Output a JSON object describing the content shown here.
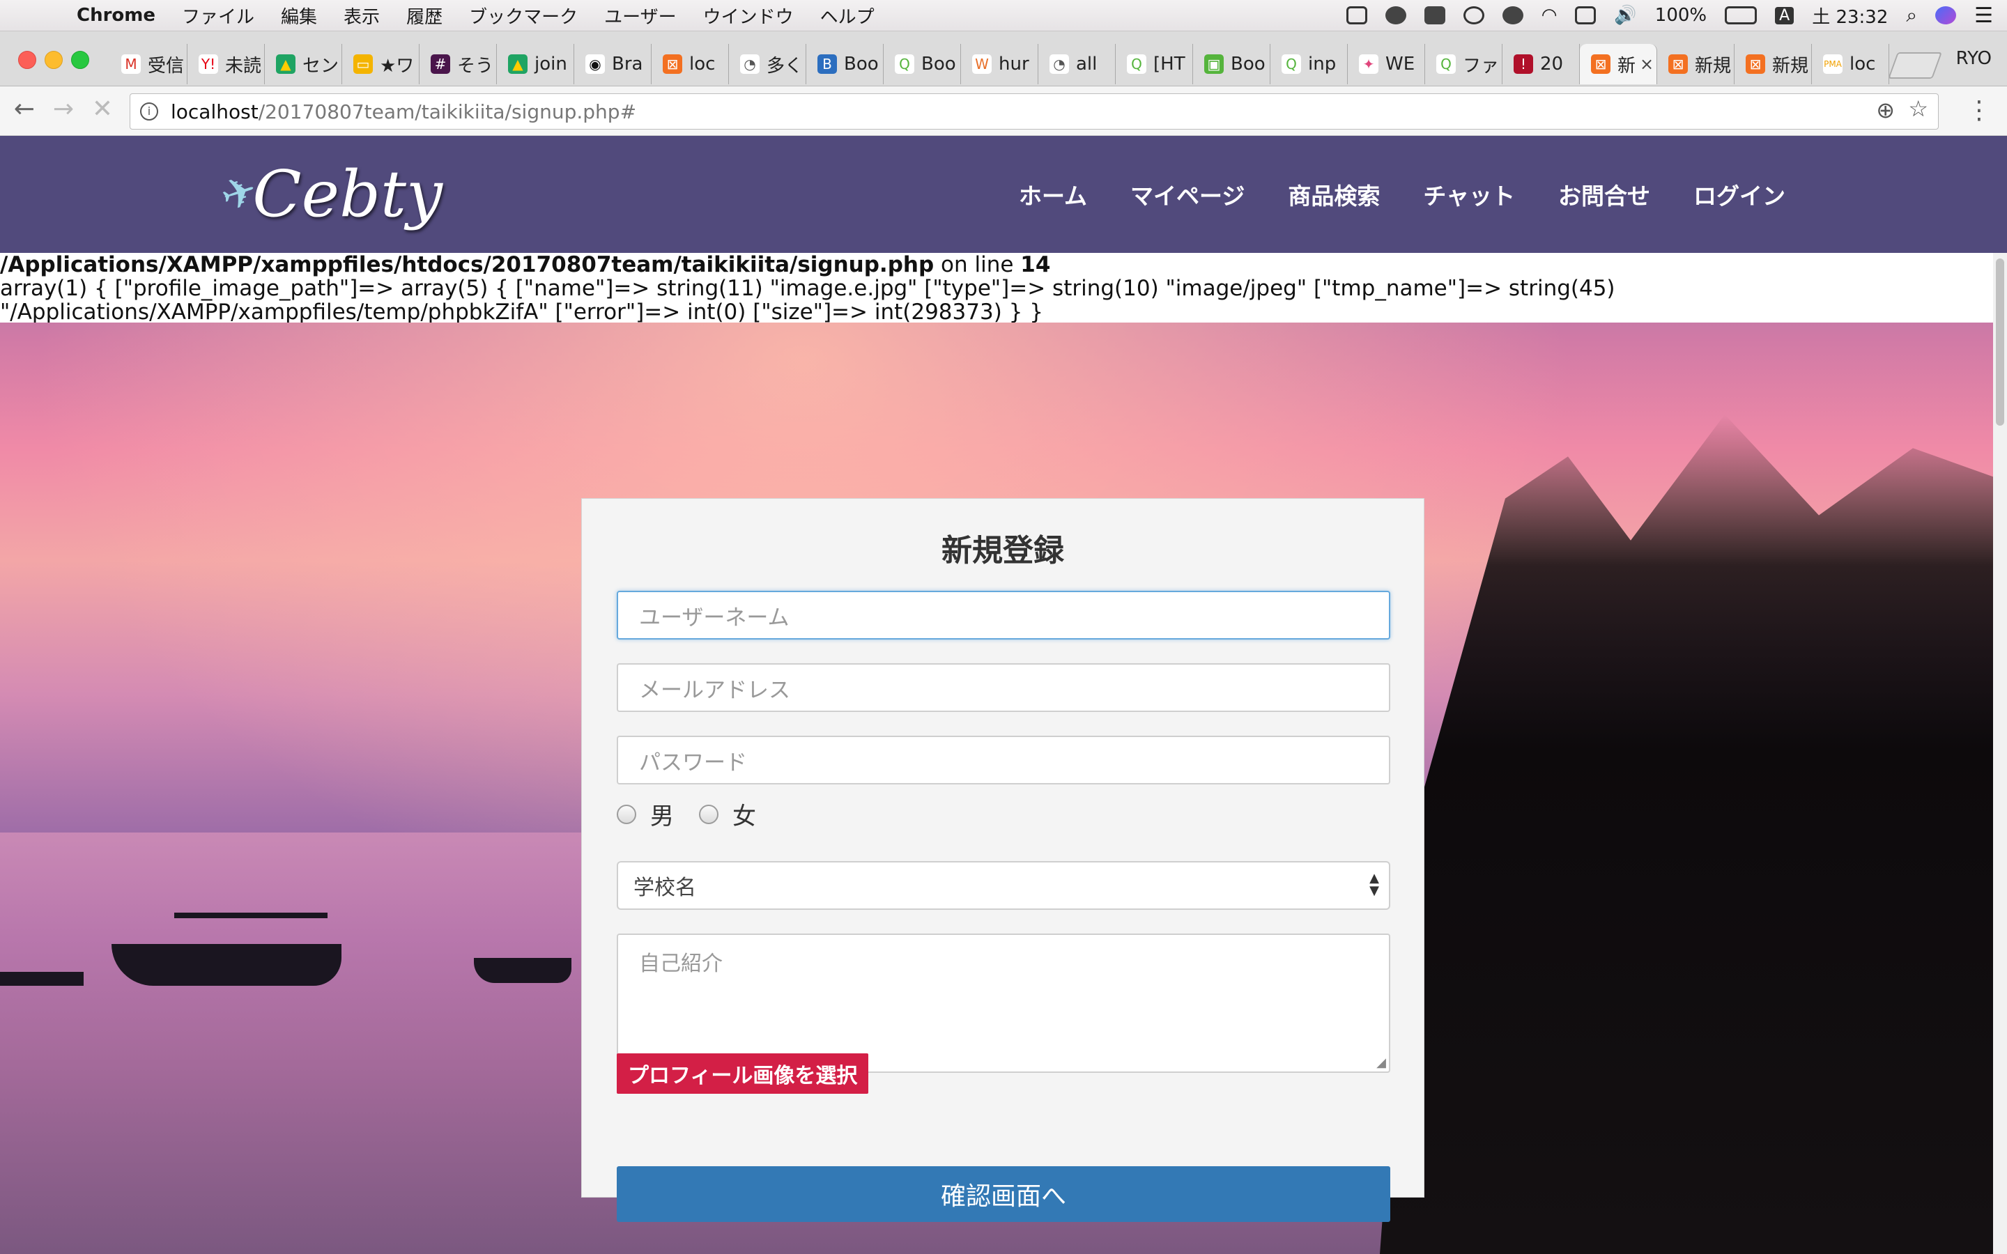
{
  "menubar": {
    "app_name": "Chrome",
    "items": [
      "ファイル",
      "編集",
      "表示",
      "履歴",
      "ブックマーク",
      "ユーザー",
      "ウインドウ",
      "ヘルプ"
    ],
    "battery": "100%",
    "input_indicator": "A",
    "clock": "土 23:32"
  },
  "tabs": [
    {
      "label": "受信",
      "color": "#ffffff",
      "glyph": "M",
      "glyph_color": "#d93025"
    },
    {
      "label": "未読",
      "color": "#ffffff",
      "glyph": "Y!",
      "glyph_color": "#e60012"
    },
    {
      "label": "セン",
      "color": "#1fa463",
      "glyph": "▲",
      "glyph_color": "#ffcc00"
    },
    {
      "label": "★ワ",
      "color": "#f4b400",
      "glyph": "▭",
      "glyph_color": "#ffffff"
    },
    {
      "label": "そう",
      "color": "#4a154b",
      "glyph": "#",
      "glyph_color": "#ffffff"
    },
    {
      "label": "join",
      "color": "#1fa463",
      "glyph": "▲",
      "glyph_color": "#ffcc00"
    },
    {
      "label": "Bra",
      "color": "#ffffff",
      "glyph": "◉",
      "glyph_color": "#111111"
    },
    {
      "label": "loc",
      "color": "#f37021",
      "glyph": "⊠",
      "glyph_color": "#ffffff"
    },
    {
      "label": "多く",
      "color": "#ffffff",
      "glyph": "◔",
      "glyph_color": "#555555"
    },
    {
      "label": "Boo",
      "color": "#2c6ebf",
      "glyph": "B",
      "glyph_color": "#ffffff"
    },
    {
      "label": "Boo",
      "color": "#ffffff",
      "glyph": "Q",
      "glyph_color": "#55b43c"
    },
    {
      "label": "hur",
      "color": "#ffffff",
      "glyph": "W",
      "glyph_color": "#e8702a"
    },
    {
      "label": "all",
      "color": "#ffffff",
      "glyph": "◔",
      "glyph_color": "#555555"
    },
    {
      "label": "[HT",
      "color": "#ffffff",
      "glyph": "Q",
      "glyph_color": "#55b43c"
    },
    {
      "label": "Boo",
      "color": "#55b43c",
      "glyph": "▣",
      "glyph_color": "#ffffff"
    },
    {
      "label": "inp",
      "color": "#ffffff",
      "glyph": "Q",
      "glyph_color": "#55b43c"
    },
    {
      "label": "WE",
      "color": "#ffffff",
      "glyph": "✦",
      "glyph_color": "#e0457b"
    },
    {
      "label": "ファ",
      "color": "#ffffff",
      "glyph": "Q",
      "glyph_color": "#55b43c"
    },
    {
      "label": "20",
      "color": "#b0102a",
      "glyph": "!",
      "glyph_color": "#ffffff"
    },
    {
      "label": "新",
      "color": "#f37021",
      "glyph": "⊠",
      "glyph_color": "#ffffff",
      "active": true
    },
    {
      "label": "新規",
      "color": "#f37021",
      "glyph": "⊠",
      "glyph_color": "#ffffff"
    },
    {
      "label": "新規",
      "color": "#f37021",
      "glyph": "⊠",
      "glyph_color": "#ffffff"
    },
    {
      "label": "loc",
      "color": "#ffffff",
      "glyph": "PMA",
      "glyph_color": "#f0a000"
    }
  ],
  "profile_name": "RYO",
  "address_bar": {
    "host": "localhost",
    "path": "/20170807team/taikikiita/signup.php#"
  },
  "site": {
    "logo_text": "Cebty",
    "nav": [
      "ホーム",
      "マイページ",
      "商品検索",
      "チャット",
      "お問合せ",
      "ログイン"
    ]
  },
  "debug": {
    "file_path": "/Applications/XAMPP/xamppfiles/htdocs/20170807team/taikikiita/signup.php",
    "on_line_text": " on line ",
    "line_number": "14",
    "dump_line_1": "array(1) { [\"profile_image_path\"]=> array(5) { [\"name\"]=> string(11) \"image.e.jpg\" [\"type\"]=> string(10) \"image/jpeg\" [\"tmp_name\"]=> string(45)",
    "dump_line_2": "\"/Applications/XAMPP/xamppfiles/temp/phpbkZifA\" [\"error\"]=> int(0) [\"size\"]=> int(298373) } }"
  },
  "form": {
    "title": "新規登録",
    "username_placeholder": "ユーザーネーム",
    "email_placeholder": "メールアドレス",
    "password_placeholder": "パスワード",
    "gender_male": "男",
    "gender_female": "女",
    "school_selected": "学校名",
    "intro_placeholder": "自己紹介",
    "profile_image_button": "プロフィール画像を選択",
    "submit_button": "確認画面へ"
  },
  "colors": {
    "header_bg": "#514a7c",
    "file_button_bg": "#d31f46",
    "submit_button_bg": "#3379b5",
    "focus_border": "#66a9dd"
  }
}
